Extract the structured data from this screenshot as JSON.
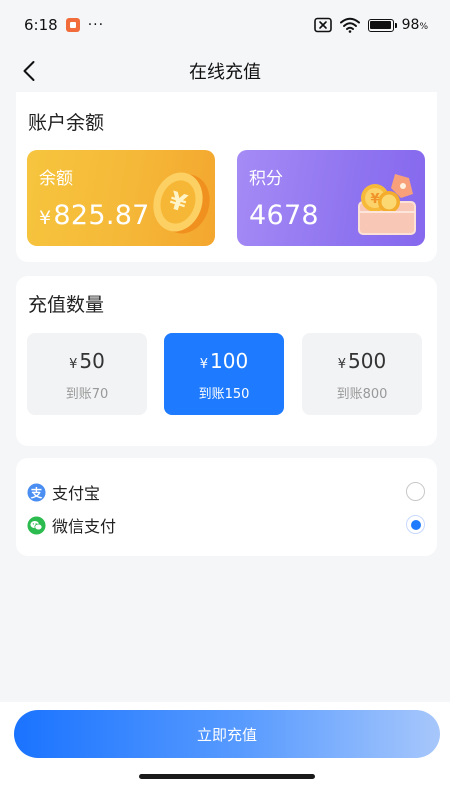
{
  "status_bar": {
    "time": "6:18",
    "more": "···",
    "battery": "98",
    "battery_unit": "%"
  },
  "nav": {
    "title": "在线充值"
  },
  "balance": {
    "section_title": "账户余额",
    "balance_label": "余额",
    "currency": "¥",
    "balance_value": "825.87",
    "points_label": "积分",
    "points_value": "4678"
  },
  "recharge": {
    "section_title": "充值数量",
    "currency": "¥",
    "options": [
      {
        "amount": "50",
        "credited": "到账70",
        "selected": false
      },
      {
        "amount": "100",
        "credited": "到账150",
        "selected": true
      },
      {
        "amount": "500",
        "credited": "到账800",
        "selected": false
      }
    ]
  },
  "payment": {
    "methods": [
      {
        "label": "支付宝",
        "icon": "alipay-icon",
        "checked": false
      },
      {
        "label": "微信支付",
        "icon": "wechat-pay-icon",
        "checked": true
      }
    ]
  },
  "footer": {
    "submit_label": "立即充值"
  },
  "colors": {
    "primary": "#1e7bff",
    "balance_tile": "#f5b838",
    "points_tile": "#8f74f0",
    "alipay": "#4b8ef2",
    "wechat": "#2bbb4e"
  }
}
